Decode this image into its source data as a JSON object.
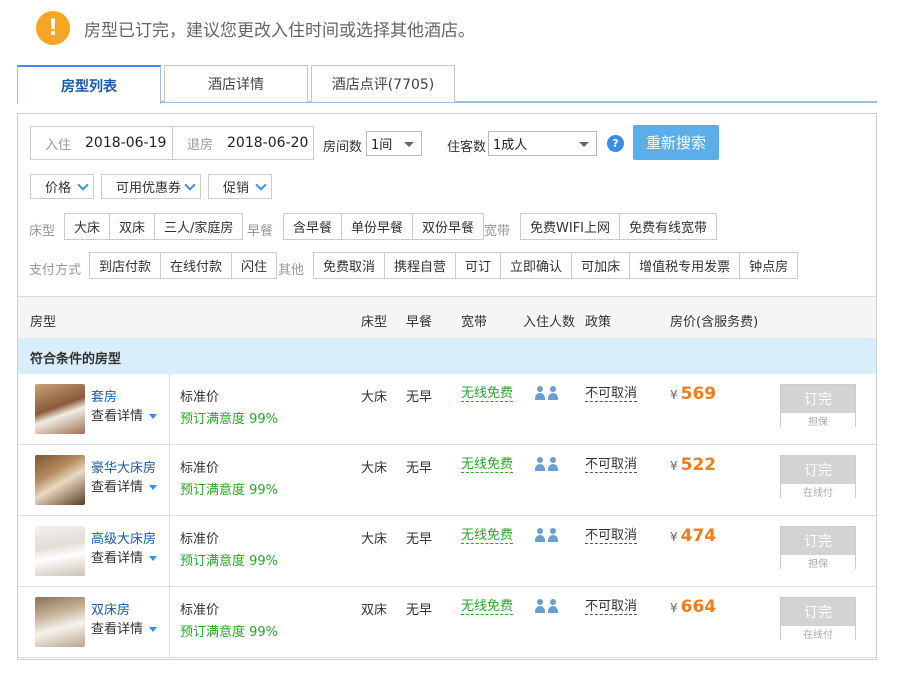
{
  "notice": {
    "icon": "exclamation-icon",
    "text": "房型已订完，建议您更改入住时间或选择其他酒店。"
  },
  "tabs": [
    "房型列表",
    "酒店详情",
    "酒店点评(7705)"
  ],
  "search": {
    "checkin_label": "入住",
    "checkin_value": "2018-06-19",
    "checkout_label": "退房",
    "checkout_value": "2018-06-20",
    "rooms_label": "房间数",
    "rooms_value": "1间",
    "guests_label": "住客数",
    "guests_value": "1成人",
    "help_icon": "question-icon",
    "help_text": "?",
    "button": "重新搜索"
  },
  "dropdowns": [
    "价格",
    "可用优惠券",
    "促销"
  ],
  "filters": {
    "bed_label": "床型",
    "bed": [
      "大床",
      "双床",
      "三人/家庭房"
    ],
    "breakfast_label": "早餐",
    "breakfast": [
      "含早餐",
      "单份早餐",
      "双份早餐"
    ],
    "net_label": "宽带",
    "net": [
      "免费WIFI上网",
      "免费有线宽带"
    ],
    "pay_label": "支付方式",
    "pay": [
      "到店付款",
      "在线付款",
      "闪住"
    ],
    "other_label": "其他",
    "other": [
      "免费取消",
      "携程自营",
      "可订",
      "立即确认",
      "可加床",
      "增值税专用发票",
      "钟点房"
    ]
  },
  "table": {
    "headers": {
      "room": "房型",
      "bed": "床型",
      "breakfast": "早餐",
      "net": "宽带",
      "guests": "入住人数",
      "policy": "政策",
      "price": "房价(含服务费)"
    },
    "section": "符合条件的房型",
    "rows": [
      {
        "name": "套房",
        "more": "查看详情",
        "rate": "标准价",
        "satisfaction": "预订满意度 99%",
        "bed": "大床",
        "breakfast": "无早",
        "net": "无线免费",
        "policy": "不可取消",
        "currency": "¥",
        "price": "569",
        "book": "订完",
        "book_sub": "担保"
      },
      {
        "name": "豪华大床房",
        "more": "查看详情",
        "rate": "标准价",
        "satisfaction": "预订满意度 99%",
        "bed": "大床",
        "breakfast": "无早",
        "net": "无线免费",
        "policy": "不可取消",
        "currency": "¥",
        "price": "522",
        "book": "订完",
        "book_sub": "在线付"
      },
      {
        "name": "高级大床房",
        "more": "查看详情",
        "rate": "标准价",
        "satisfaction": "预订满意度 99%",
        "bed": "大床",
        "breakfast": "无早",
        "net": "无线免费",
        "policy": "不可取消",
        "currency": "¥",
        "price": "474",
        "book": "订完",
        "book_sub": "担保"
      },
      {
        "name": "双床房",
        "more": "查看详情",
        "rate": "标准价",
        "satisfaction": "预订满意度 99%",
        "bed": "双床",
        "breakfast": "无早",
        "net": "无线免费",
        "policy": "不可取消",
        "currency": "¥",
        "price": "664",
        "book": "订完",
        "book_sub": "在线付"
      }
    ]
  },
  "colors": {
    "accent": "#3a8ee6",
    "price": "#f07c1e",
    "green": "#2aa52a",
    "section_bg": "#d9eefb",
    "warn": "#f5a623"
  }
}
